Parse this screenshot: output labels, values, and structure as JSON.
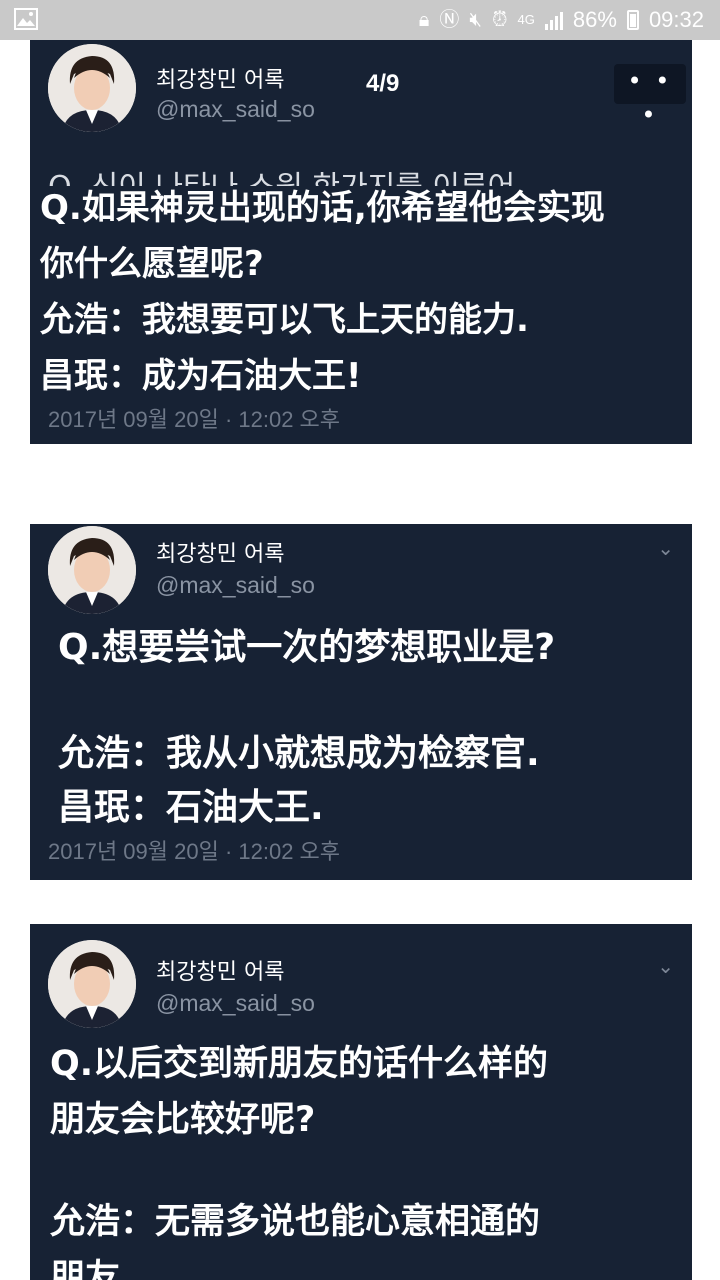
{
  "status_bar": {
    "battery": "86%",
    "time": "09:32",
    "network": "4G"
  },
  "cards": [
    {
      "author_name": "최강창민 어록",
      "handle": "@max_said_so",
      "page_counter": "4/9",
      "more_label": "• • •",
      "original_text_cut": "Q. 신이 나타나 소원 한가지를 이루어",
      "question": "Q.如果神灵出现的话,你希望他会实现\n你什么愿望呢?",
      "answer_1": "允浩：我想要可以飞上天的能力.",
      "answer_2": "昌珉：成为石油大王!",
      "timestamp": "2017년 09월 20일 · 12:02 오후"
    },
    {
      "author_name": "최강창민 어록",
      "handle": "@max_said_so",
      "question": "Q.想要尝试一次的梦想职业是?",
      "answer_1": "允浩：我从小就想成为检察官.",
      "answer_2": "昌珉：石油大王.",
      "timestamp": "2017년 09월 20일 · 12:02 오후"
    },
    {
      "author_name": "최강창민 어록",
      "handle": "@max_said_so",
      "question": "Q.以后交到新朋友的话什么样的\n朋友会比较好呢?",
      "answer_1": "允浩：无需多说也能心意相通的\n朋友."
    }
  ],
  "colors": {
    "card_bg": "#172234",
    "handle": "#8a94a3",
    "timestamp": "#6e7888",
    "status_bar": "#c9c9c9"
  }
}
